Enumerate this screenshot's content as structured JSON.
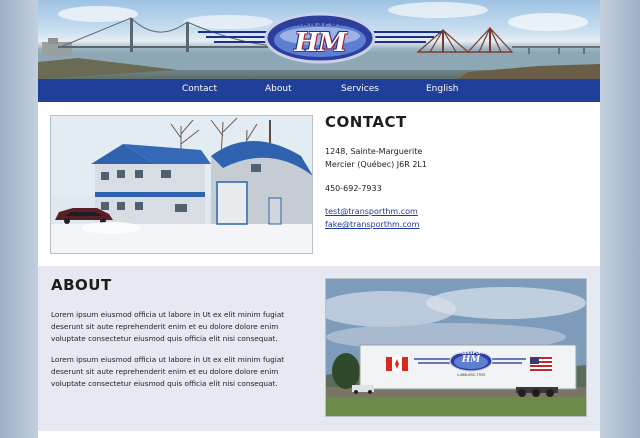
{
  "header": {
    "logo_top": "TRANSPORT",
    "logo_mark": "HM"
  },
  "nav": {
    "items": [
      {
        "label": "Contact"
      },
      {
        "label": "About"
      },
      {
        "label": "Services"
      },
      {
        "label": "English"
      }
    ]
  },
  "contact": {
    "title": "CONTACT",
    "address_line1": "1248, Sainte-Marguerite",
    "address_line2": "Mercier (Québec) J6R 2L1",
    "phone": "450-692-7933",
    "email1": "test@transporthm.com",
    "email2": "fake@transporthm.com"
  },
  "about": {
    "title": "ABOUT",
    "paragraph1": "Lorem ipsum eiusmod officia ut labore in Ut ex elit minim fugiat deserunt sit aute reprehenderit enim et eu dolore dolore enim voluptate consectetur eiusmod quis officia elit nisi consequat.",
    "paragraph2": "Lorem ipsum eiusmod officia ut labore in Ut ex elit minim fugiat deserunt sit aute reprehenderit enim et eu dolore dolore enim voluptate consectetur eiusmod quis officia elit nisi consequat.",
    "truck_logo_top": "TRANSPORT",
    "truck_logo_mark": "HM",
    "truck_phone": "1-866-692-7933"
  },
  "colors": {
    "nav_bg": "#1f3f9a",
    "about_bg": "#e6e9f1",
    "link": "#1f3a9a"
  }
}
